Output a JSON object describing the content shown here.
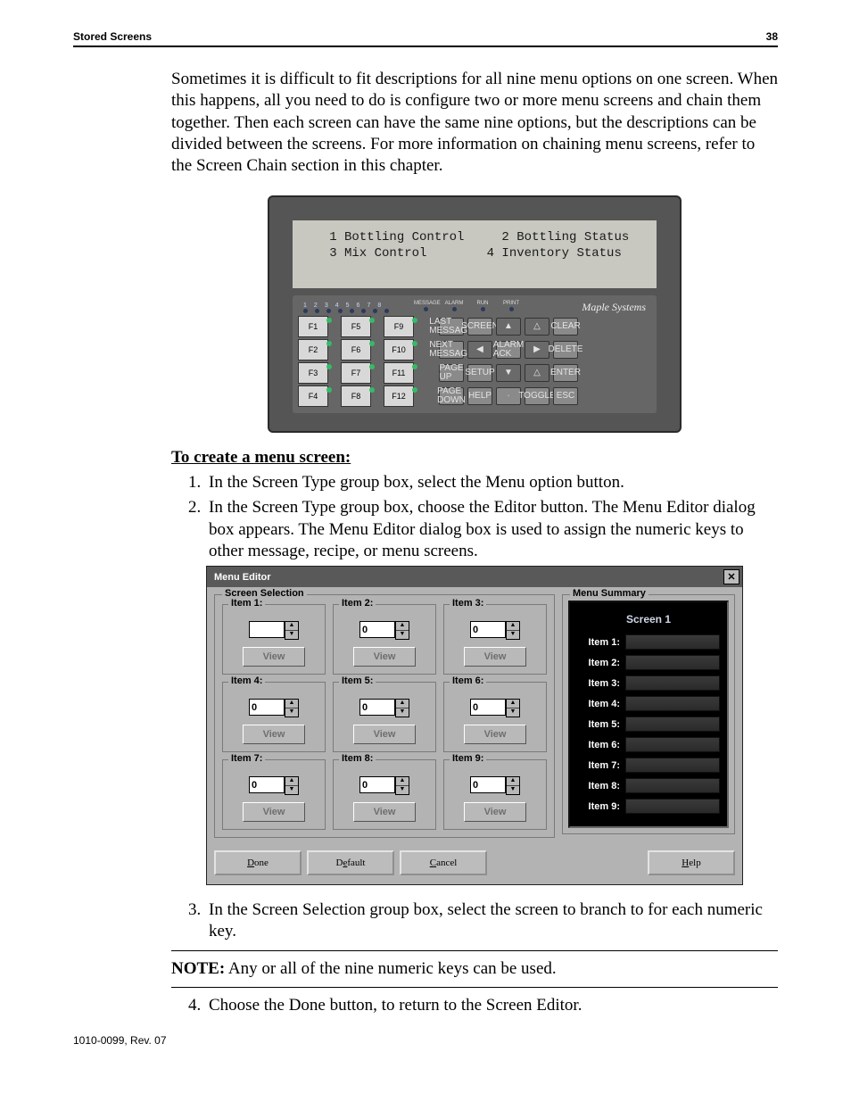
{
  "header": {
    "title": "Stored Screens",
    "page": "38"
  },
  "para": "Sometimes it is difficult to fit descriptions for all nine menu options on one screen. When this happens, all you need to do is configure two or more menu screens and chain them together. Then each screen can have the same nine options, but the descriptions can be divided between the screens. For more information on chaining menu screens, refer to the Screen Chain section in this chapter.",
  "hmi": {
    "lcd": "   1 Bottling Control     2 Bottling Status\n   3 Mix Control        4 Inventory Status",
    "nums": [
      "1",
      "2",
      "3",
      "4",
      "5",
      "6",
      "7",
      "8"
    ],
    "topmini": [
      "MESSAGE",
      "ALARM",
      "RUN",
      "PRINT"
    ],
    "brand": "Maple Systems",
    "fkeys": [
      [
        "F1",
        "F5",
        "F9"
      ],
      [
        "F2",
        "F6",
        "F10"
      ],
      [
        "F3",
        "F7",
        "F11"
      ],
      [
        "F4",
        "F8",
        "F12"
      ]
    ],
    "side": [
      [
        "LAST MESSAGE",
        "SCREEN",
        "▲",
        "△",
        "CLEAR"
      ],
      [
        "NEXT MESSAGE",
        "◀",
        "ALARM ACK",
        "▶",
        "DELETE"
      ],
      [
        "PAGE UP",
        "SETUP",
        "▼",
        "△",
        "ENTER"
      ],
      [
        "PAGE DOWN",
        "HELP",
        "·",
        "TOGGLE",
        "ESC"
      ]
    ]
  },
  "section": "To create a menu screen:",
  "steps": [
    "In the Screen Type group box, select the Menu option button.",
    "In the Screen Type group box, choose the Editor button. The Menu Editor dialog box appears. The Menu Editor dialog box is used to assign the numeric keys to other message, recipe, or menu screens."
  ],
  "dialog": {
    "title": "Menu Editor",
    "sel_title": "Screen Selection",
    "sum_title": "Menu Summary",
    "items": [
      {
        "label": "Item 1:",
        "val": ""
      },
      {
        "label": "Item 2:",
        "val": "0"
      },
      {
        "label": "Item 3:",
        "val": "0"
      },
      {
        "label": "Item 4:",
        "val": "0"
      },
      {
        "label": "Item 5:",
        "val": "0"
      },
      {
        "label": "Item 6:",
        "val": "0"
      },
      {
        "label": "Item 7:",
        "val": "0"
      },
      {
        "label": "Item 8:",
        "val": "0"
      },
      {
        "label": "Item 9:",
        "val": "0"
      }
    ],
    "view": "View",
    "summary_head": "Screen 1",
    "summary_rows": [
      "Item 1:",
      "Item 2:",
      "Item 3:",
      "Item 4:",
      "Item 5:",
      "Item 6:",
      "Item 7:",
      "Item 8:",
      "Item 9:"
    ],
    "buttons": {
      "done": "Done",
      "default": "Default",
      "cancel": "Cancel",
      "help": "Help"
    }
  },
  "step3": "In the Screen Selection group box, select the screen to branch to for each numeric key.",
  "note_label": "NOTE:",
  "note": "Any or all of the nine numeric keys can be used.",
  "step4": "Choose the Done button, to return to the Screen Editor.",
  "footer": "1010-0099, Rev. 07"
}
